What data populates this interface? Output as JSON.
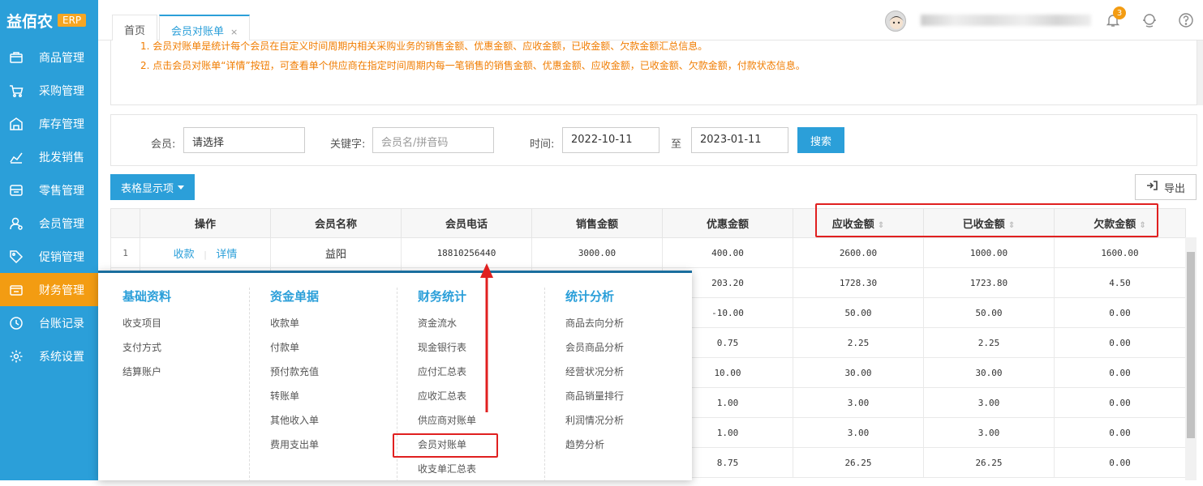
{
  "app": {
    "brand": "益佰农",
    "badge": "ERP"
  },
  "sidebar": {
    "items": [
      {
        "label": "商品管理",
        "icon": "box-icon"
      },
      {
        "label": "采购管理",
        "icon": "cart-icon"
      },
      {
        "label": "库存管理",
        "icon": "warehouse-icon"
      },
      {
        "label": "批发销售",
        "icon": "chart-icon"
      },
      {
        "label": "零售管理",
        "icon": "store-icon"
      },
      {
        "label": "会员管理",
        "icon": "user-icon"
      },
      {
        "label": "促销管理",
        "icon": "tag-icon"
      },
      {
        "label": "财务管理",
        "icon": "wallet-icon",
        "active": true
      },
      {
        "label": "台账记录",
        "icon": "clock-icon"
      },
      {
        "label": "系统设置",
        "icon": "gear-icon"
      }
    ]
  },
  "tabs": [
    {
      "label": "首页"
    },
    {
      "label": "会员对账单",
      "active": true,
      "close": "×"
    }
  ],
  "header": {
    "notifications": "3"
  },
  "tips": [
    "1. 会员对账单是统计每个会员在自定义时间周期内相关采购业务的销售金额、优惠金额、应收金额，已收金额、欠款金额汇总信息。",
    "2. 点击会员对账单“详情”按钮，可查看单个供应商在指定时间周期内每一笔销售的销售金额、优惠金额、应收金额，已收金额、欠款金额，付款状态信息。"
  ],
  "search": {
    "member_label": "会员:",
    "member_value": "请选择",
    "keyword_label": "关键字:",
    "keyword_placeholder": "会员名/拼音码",
    "time_label": "时间:",
    "date_from": "2022-10-11",
    "to_label": "至",
    "date_to": "2023-01-11",
    "button": "搜索"
  },
  "toolbar": {
    "columns_button": "表格显示项",
    "export_button": "导出"
  },
  "table": {
    "headers": [
      "",
      "操作",
      "会员名称",
      "会员电话",
      "销售金额",
      "优惠金额",
      "应收金额",
      "已收金额",
      "欠款金额"
    ],
    "op_collect": "收款",
    "op_detail": "详情",
    "rows": [
      {
        "idx": "1",
        "name": "益阳",
        "phone": "18810256440",
        "sales": "3000.00",
        "discount": "400.00",
        "receivable": "2600.00",
        "received": "1000.00",
        "owed": "1600.00"
      },
      {
        "discount": "203.20",
        "receivable": "1728.30",
        "received": "1723.80",
        "owed": "4.50"
      },
      {
        "discount": "-10.00",
        "receivable": "50.00",
        "received": "50.00",
        "owed": "0.00"
      },
      {
        "discount": "0.75",
        "receivable": "2.25",
        "received": "2.25",
        "owed": "0.00"
      },
      {
        "discount": "10.00",
        "receivable": "30.00",
        "received": "30.00",
        "owed": "0.00"
      },
      {
        "discount": "1.00",
        "receivable": "3.00",
        "received": "3.00",
        "owed": "0.00"
      },
      {
        "discount": "1.00",
        "receivable": "3.00",
        "received": "3.00",
        "owed": "0.00"
      },
      {
        "discount": "8.75",
        "receivable": "26.25",
        "received": "26.25",
        "owed": "0.00"
      }
    ]
  },
  "menu": {
    "columns": [
      {
        "title": "基础资料",
        "items": [
          "收支项目",
          "支付方式",
          "结算账户"
        ]
      },
      {
        "title": "资金单据",
        "items": [
          "收款单",
          "付款单",
          "预付款充值",
          "转账单",
          "其他收入单",
          "费用支出单"
        ]
      },
      {
        "title": "财务统计",
        "items": [
          "资金流水",
          "现金银行表",
          "应付汇总表",
          "应收汇总表",
          "供应商对账单",
          "会员对账单",
          "收支单汇总表"
        ]
      },
      {
        "title": "统计分析",
        "items": [
          "商品去向分析",
          "会员商品分析",
          "经营状况分析",
          "商品销量排行",
          "利润情况分析",
          "趋势分析"
        ]
      }
    ]
  },
  "colors": {
    "primary": "#2b9fd9",
    "active_nav": "#f39c12",
    "tip_text": "#f07c00",
    "highlight": "#e02020"
  }
}
